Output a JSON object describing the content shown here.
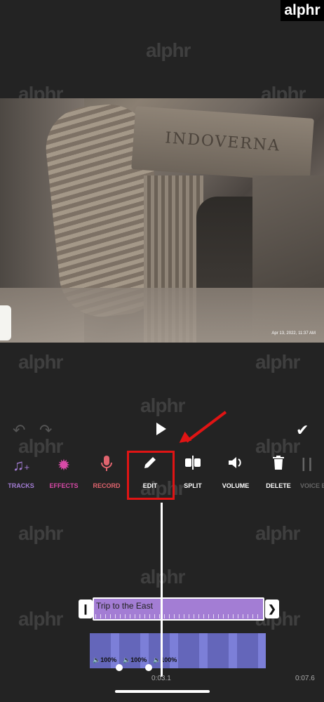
{
  "logo": "alphr",
  "watermark": "alphr",
  "video": {
    "sign_text": "INDOVERNA",
    "timestamp": "Apr 13, 2022, 11:37 AM"
  },
  "controls": {
    "undo_icon": "undo-icon",
    "redo_icon": "redo-icon",
    "play_icon": "play-icon",
    "confirm_icon": "check-icon"
  },
  "toolbar": [
    {
      "label": "TRACKS",
      "icon": "music-note-add-icon",
      "color": "#a37dd4"
    },
    {
      "label": "EFFECTS",
      "icon": "starburst-icon",
      "color": "#d94aa8"
    },
    {
      "label": "RECORD",
      "icon": "microphone-icon",
      "color": "#e0646e"
    },
    {
      "label": "EDIT",
      "icon": "pencil-icon",
      "color": "#ffffff"
    },
    {
      "label": "SPLIT",
      "icon": "split-icon",
      "color": "#ffffff"
    },
    {
      "label": "VOLUME",
      "icon": "speaker-icon",
      "color": "#ffffff"
    },
    {
      "label": "DELETE",
      "icon": "trash-icon",
      "color": "#ffffff"
    },
    {
      "label": "VOICE E",
      "icon": "waveform-icon",
      "color": "#666666"
    }
  ],
  "timeline": {
    "text_clip_label": "Trip to the East",
    "volumes": [
      "🔈100%",
      "🔈100%",
      "🔈100%"
    ],
    "current_time": "0:03.1",
    "total_time": "0:07.6"
  },
  "colors": {
    "background": "#232323",
    "accent_purple": "#a37dd4",
    "highlight_red": "#e01414",
    "clip_blue": "#7275d2"
  }
}
